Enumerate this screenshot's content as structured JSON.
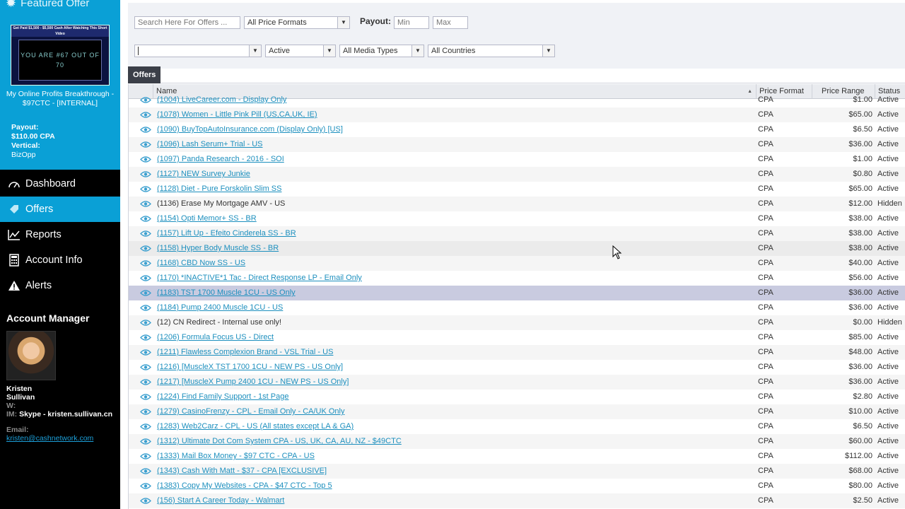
{
  "featured": {
    "title": "Featured Offer",
    "thumb_banner": "Get Paid $1,500 - $5,500 Cash After Watching This Short Video",
    "thumb_screen": "YOU ARE #67 OUT OF 70",
    "offer_name": "My Online Profits Breakthrough - $97CTC - [INTERNAL]",
    "payout_label": "Payout:",
    "payout_value": "$110.00 CPA",
    "vertical_label": "Vertical:",
    "vertical_value": "BizOpp"
  },
  "nav": {
    "items": [
      {
        "label": "Dashboard",
        "icon": "speedometer-icon"
      },
      {
        "label": "Offers",
        "icon": "tag-icon",
        "active": true
      },
      {
        "label": "Reports",
        "icon": "chart-icon"
      },
      {
        "label": "Account Info",
        "icon": "calculator-icon"
      },
      {
        "label": "Alerts",
        "icon": "warning-icon"
      }
    ]
  },
  "account_manager": {
    "heading": "Account Manager",
    "name": "Kristen Sullivan",
    "w_label": "W:",
    "im_label": "IM:",
    "im_value": "Skype - kristen.sullivan.cn",
    "email_label": "Email:",
    "email_value": "kristen@cashnetwork.com"
  },
  "filters": {
    "search_placeholder": "Search Here For Offers ...",
    "price_format": "All Price Formats",
    "payout_label": "Payout:",
    "payout_min_placeholder": "Min",
    "payout_max_placeholder": "Max",
    "blank_select": "",
    "status": "Active",
    "media_types": "All Media Types",
    "countries": "All Countries"
  },
  "tab": {
    "label": "Offers"
  },
  "columns": {
    "name": "Name",
    "price_format": "Price Format",
    "price_range": "Price Range",
    "status": "Status"
  },
  "rows": [
    {
      "name": "(1004) LiveCareer.com - Display Only",
      "format": "CPA",
      "price": "$1.00",
      "status": "Active",
      "link": true
    },
    {
      "name": "(1078) Women - Little Pink Pill (US,CA,UK, IE)",
      "format": "CPA",
      "price": "$65.00",
      "status": "Active",
      "link": true
    },
    {
      "name": "(1090) BuyTopAutoInsurance.com (Display Only) [US]",
      "format": "CPA",
      "price": "$6.50",
      "status": "Active",
      "link": true
    },
    {
      "name": "(1096) Lash Serum+ Trial - US",
      "format": "CPA",
      "price": "$36.00",
      "status": "Active",
      "link": true
    },
    {
      "name": "(1097) Panda Research - 2016 - SOI",
      "format": "CPA",
      "price": "$1.00",
      "status": "Active",
      "link": true
    },
    {
      "name": "(1127) NEW Survey Junkie",
      "format": "CPA",
      "price": "$0.80",
      "status": "Active",
      "link": true
    },
    {
      "name": "(1128) Diet - Pure Forskolin Slim SS",
      "format": "CPA",
      "price": "$65.00",
      "status": "Active",
      "link": true
    },
    {
      "name": "(1136) Erase My Mortgage AMV - US",
      "format": "CPA",
      "price": "$12.00",
      "status": "Hidden",
      "link": false
    },
    {
      "name": "(1154) Opti Memor+ SS - BR",
      "format": "CPA",
      "price": "$38.00",
      "status": "Active",
      "link": true
    },
    {
      "name": "(1157) Lift Up - Efeito Cinderela SS - BR",
      "format": "CPA",
      "price": "$38.00",
      "status": "Active",
      "link": true
    },
    {
      "name": "(1158) Hyper Body Muscle SS - BR",
      "format": "CPA",
      "price": "$38.00",
      "status": "Active",
      "link": true,
      "hover": true
    },
    {
      "name": "(1168) CBD Now SS - US",
      "format": "CPA",
      "price": "$40.00",
      "status": "Active",
      "link": true
    },
    {
      "name": "(1170) *INACTIVE*1 Tac - Direct Response LP - Email Only",
      "format": "CPA",
      "price": "$56.00",
      "status": "Active",
      "link": true
    },
    {
      "name": "(1183) TST 1700 Muscle 1CU - US Only",
      "format": "CPA",
      "price": "$36.00",
      "status": "Active",
      "link": true,
      "selected": true
    },
    {
      "name": "(1184) Pump 2400 Muscle 1CU - US",
      "format": "CPA",
      "price": "$36.00",
      "status": "Active",
      "link": true
    },
    {
      "name": "(12) CN Redirect - Internal use only!",
      "format": "CPA",
      "price": "$0.00",
      "status": "Hidden",
      "link": false
    },
    {
      "name": "(1206) Formula Focus US - Direct",
      "format": "CPA",
      "price": "$85.00",
      "status": "Active",
      "link": true
    },
    {
      "name": "(1211) Flawless Complexion Brand - VSL Trial - US",
      "format": "CPA",
      "price": "$48.00",
      "status": "Active",
      "link": true
    },
    {
      "name": "(1216) [MuscleX TST 1700 1CU - NEW PS - US Only]",
      "format": "CPA",
      "price": "$36.00",
      "status": "Active",
      "link": true
    },
    {
      "name": "(1217) [MuscleX Pump 2400 1CU - NEW PS - US Only]",
      "format": "CPA",
      "price": "$36.00",
      "status": "Active",
      "link": true
    },
    {
      "name": "(1224) Find Family Support - 1st Page",
      "format": "CPA",
      "price": "$2.80",
      "status": "Active",
      "link": true
    },
    {
      "name": "(1279) CasinoFrenzy - CPL - Email Only - CA/UK Only",
      "format": "CPA",
      "price": "$10.00",
      "status": "Active",
      "link": true
    },
    {
      "name": "(1283) Web2Carz - CPL - US (All states except LA & GA)",
      "format": "CPA",
      "price": "$6.50",
      "status": "Active",
      "link": true
    },
    {
      "name": "(1312) Ultimate Dot Com System CPA - US, UK, CA, AU, NZ - $49CTC",
      "format": "CPA",
      "price": "$60.00",
      "status": "Active",
      "link": true
    },
    {
      "name": "(1333) Mail Box Money - $97 CTC - CPA - US",
      "format": "CPA",
      "price": "$112.00",
      "status": "Active",
      "link": true
    },
    {
      "name": "(1343) Cash With Matt - $37 - CPA [EXCLUSIVE]",
      "format": "CPA",
      "price": "$68.00",
      "status": "Active",
      "link": true
    },
    {
      "name": "(1383) Copy My Websites - CPA - $47 CTC - Top 5",
      "format": "CPA",
      "price": "$80.00",
      "status": "Active",
      "link": true
    },
    {
      "name": "(156) Start A Career Today - Walmart",
      "format": "CPA",
      "price": "$2.50",
      "status": "Active",
      "link": true
    }
  ],
  "colors": {
    "accent": "#0aa0d6",
    "sidebar_bg": "#000000",
    "link": "#1c8fbe",
    "selected_row": "#c9cbe0"
  }
}
